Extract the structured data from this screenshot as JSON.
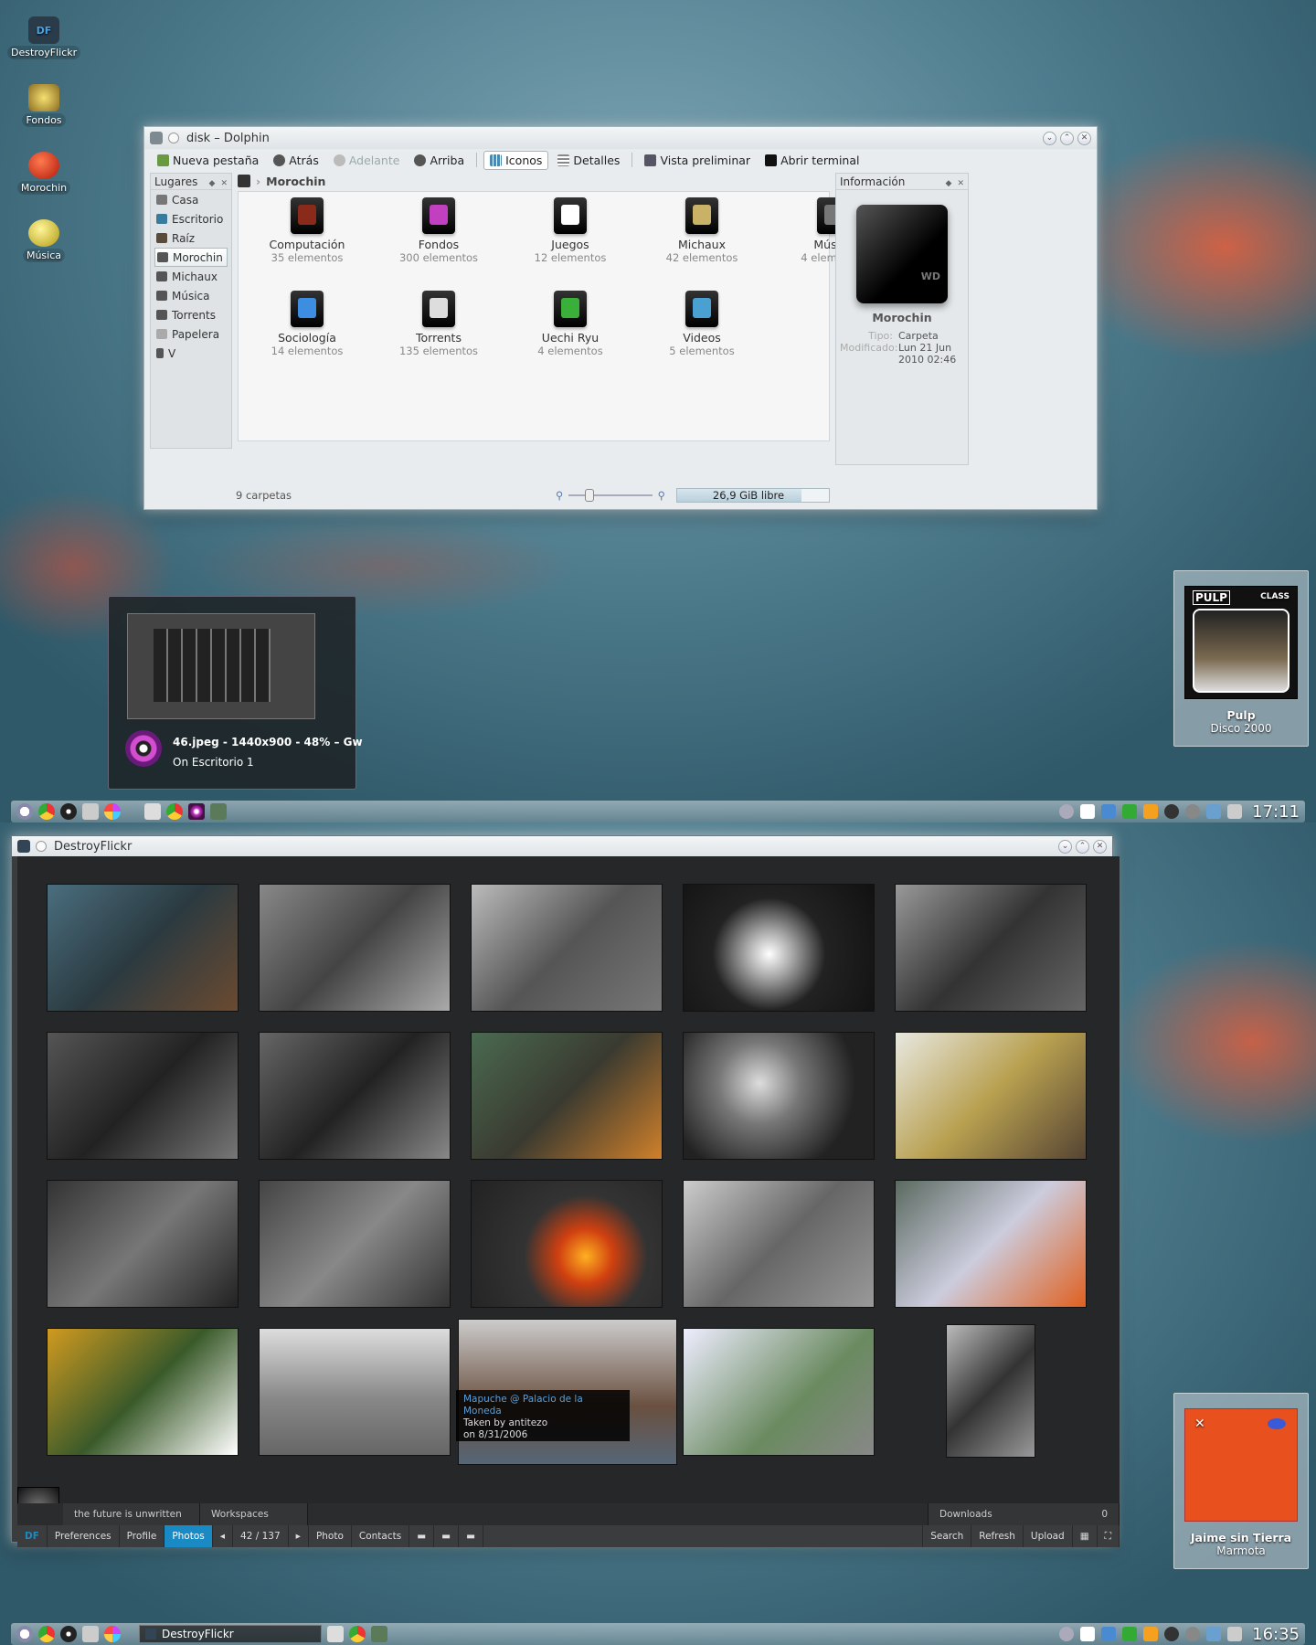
{
  "desktop_icons": [
    {
      "label": "DestroyFlickr",
      "glyph": "DF",
      "color": "#2a3b4a"
    },
    {
      "label": "Fondos",
      "glyph": "",
      "color": "#d9b54a"
    },
    {
      "label": "Morochin",
      "glyph": "",
      "color": "#d8321c"
    },
    {
      "label": "Música",
      "glyph": "",
      "color": "#e0cf40"
    }
  ],
  "dolphin": {
    "title": "disk – Dolphin",
    "toolbar": {
      "new_tab": "Nueva pestaña",
      "back": "Atrás",
      "forward": "Adelante",
      "up": "Arriba",
      "icons": "Iconos",
      "details": "Detalles",
      "preview": "Vista preliminar",
      "terminal": "Abrir terminal"
    },
    "places_title": "Lugares",
    "places": [
      "Casa",
      "Escritorio",
      "Raíz",
      "Morochin",
      "Michaux",
      "Música",
      "Torrents",
      "Papelera",
      "V"
    ],
    "selected_place": "Morochin",
    "breadcrumb": "Morochin",
    "files": [
      {
        "name": "Computación",
        "count": "35 elementos",
        "accent": "#8a2a1a"
      },
      {
        "name": "Fondos",
        "count": "300 elementos",
        "accent": "#c040c0"
      },
      {
        "name": "Juegos",
        "count": "12 elementos",
        "accent": "#ffffff"
      },
      {
        "name": "Michaux",
        "count": "42 elementos",
        "accent": "#c9b267"
      },
      {
        "name": "Música",
        "count": "4 elementos",
        "accent": "#777777"
      },
      {
        "name": "Sociología",
        "count": "14 elementos",
        "accent": "#3d8ee0"
      },
      {
        "name": "Torrents",
        "count": "135 elementos",
        "accent": "#dddddd"
      },
      {
        "name": "Uechi Ryu",
        "count": "4 elementos",
        "accent": "#3ab03a"
      },
      {
        "name": "Videos",
        "count": "5 elementos",
        "accent": "#4aa0d0"
      }
    ],
    "info": {
      "title": "Información",
      "name": "Morochin",
      "type_label": "Tipo:",
      "type_value": "Carpeta",
      "modified_label": "Modificado:",
      "modified_value": "Lun 21 Jun 2010 02:46"
    },
    "status": {
      "folders": "9 carpetas",
      "free": "26,9 GiB libre",
      "used_fraction": 0.82
    }
  },
  "preview_tooltip": {
    "title": "46.jpeg - 1440x900 - 48% – Gw",
    "subtitle": "On Escritorio 1"
  },
  "now_playing_top": {
    "artist": "Pulp",
    "album": "Disco 2000",
    "cover_text": "PULP",
    "cover_sub": "CLASS"
  },
  "now_playing_bottom": {
    "artist": "Jaime sin Tierra",
    "album": "Marmota"
  },
  "taskbar_top": {
    "clock": "17:11"
  },
  "taskbar_bottom": {
    "clock": "16:35",
    "task": "DestroyFlickr"
  },
  "destroyflickr": {
    "title": "DestroyFlickr",
    "tooltip": {
      "title": "Mapuche @ Palacio de la Moneda",
      "author": "Taken by antitezo",
      "date": "on 8/31/2006"
    },
    "bar1": {
      "motto": "the future is unwritten",
      "workspaces": "Workspaces",
      "downloads": "Downloads",
      "downloads_count": "0"
    },
    "bar2": {
      "logo": "DF",
      "preferences": "Preferences",
      "profile": "Profile",
      "photos": "Photos",
      "pager": "42 / 137",
      "photo": "Photo",
      "contacts": "Contacts",
      "search": "Search",
      "refresh": "Refresh",
      "upload": "Upload"
    },
    "photos": [
      {
        "bg": "linear-gradient(135deg,#4a6e7e,#2b3a40 50%,#6b4a30)"
      },
      {
        "bg": "linear-gradient(135deg,#888,#444 50%,#aaa)"
      },
      {
        "bg": "linear-gradient(135deg,#bbb,#555 50%,#777)"
      },
      {
        "bg": "radial-gradient(circle at 45% 55%,#fff,#aaa 18%,#222 45%,#111)"
      },
      {
        "bg": "linear-gradient(135deg,#999,#333 50%,#666)"
      },
      {
        "bg": "linear-gradient(135deg,#555,#222 50%,#777)"
      },
      {
        "bg": "linear-gradient(135deg,#666,#222 50%,#888)"
      },
      {
        "bg": "linear-gradient(135deg,#4a6a50,#3a3a30 50%,#d0802a)"
      },
      {
        "bg": "radial-gradient(circle at 40% 40%,#ddd,#777 30%,#222 70%)"
      },
      {
        "bg": "linear-gradient(135deg,#e8e8e0,#b8a050 50%,#554433)"
      },
      {
        "bg": "linear-gradient(135deg,#333,#777 50%,#222)"
      },
      {
        "bg": "linear-gradient(135deg,#444,#888 50%,#333)"
      },
      {
        "bg": "radial-gradient(circle at 60% 60%,#ffb020,#d04010 20%,#333 45%,#222)"
      },
      {
        "bg": "linear-gradient(135deg,#ccc,#666 50%,#999)"
      },
      {
        "bg": "linear-gradient(135deg,#5a6a60,#ccd 50%,#e06020)"
      },
      {
        "bg": "linear-gradient(135deg,#d09a20,#3a5a2a 50%,#ffffff)"
      },
      {
        "bg": "linear-gradient(180deg,#ddd,#888 55%,#666)"
      },
      {
        "bg": "linear-gradient(180deg,#cccccc,#6a5040 60%,#556677)"
      },
      {
        "bg": "linear-gradient(135deg,#eef,#6a8a60 60%,#888)"
      },
      {
        "bg": "linear-gradient(135deg,#bbb,#333 50%,#999)"
      }
    ]
  }
}
